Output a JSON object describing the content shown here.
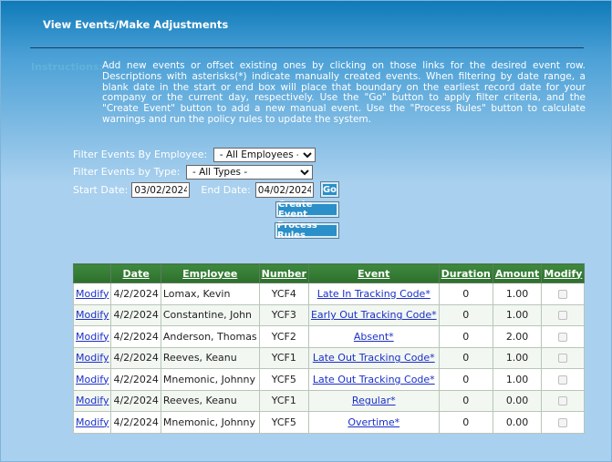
{
  "page": {
    "title": "View Events/Make Adjustments"
  },
  "instructions": {
    "label": "Instructions:",
    "text": "Add new events or offset existing ones by clicking on those links for the desired event row. Descriptions with asterisks(*) indicate manually created events.  When filtering by date range, a blank date in the start or end box will place that boundary on the earliest record date for your company or the current day, respectively. Use the \"Go\" button to apply filter criteria, and the \"Create Event\" button to add a new manual event. Use the \"Process Rules\" button to calculate warnings and run the policy rules to update the system."
  },
  "filters": {
    "employee_label": "Filter Events By Employee:",
    "employee_value": "- All Employees -",
    "type_label": "Filter Events by Type:",
    "type_value": "- All Types -",
    "start_label": "Start Date:",
    "start_value": "03/02/2024",
    "end_label": "End Date:",
    "end_value": "04/02/2024",
    "go_label": "Go"
  },
  "actions": {
    "create_event_label": "Create Event",
    "process_rules_label": "Process Rules"
  },
  "table": {
    "headers": [
      "",
      "Date",
      "Employee",
      "Number",
      "Event",
      "Duration",
      "Amount",
      "Modify"
    ],
    "rows": [
      {
        "action": "Modify",
        "date": "4/2/2024",
        "employee": "Lomax, Kevin",
        "number": "YCF4",
        "event": "Late In Tracking Code*",
        "duration": "0",
        "amount": "1.00"
      },
      {
        "action": "Modify",
        "date": "4/2/2024",
        "employee": "Constantine, John",
        "number": "YCF3",
        "event": "Early Out Tracking Code*",
        "duration": "0",
        "amount": "1.00"
      },
      {
        "action": "Modify",
        "date": "4/2/2024",
        "employee": "Anderson, Thomas",
        "number": "YCF2",
        "event": "Absent*",
        "duration": "0",
        "amount": "2.00"
      },
      {
        "action": "Modify",
        "date": "4/2/2024",
        "employee": "Reeves, Keanu",
        "number": "YCF1",
        "event": "Late Out Tracking Code*",
        "duration": "0",
        "amount": "1.00"
      },
      {
        "action": "Modify",
        "date": "4/2/2024",
        "employee": "Mnemonic, Johnny",
        "number": "YCF5",
        "event": "Late Out Tracking Code*",
        "duration": "0",
        "amount": "1.00"
      },
      {
        "action": "Modify",
        "date": "4/2/2024",
        "employee": "Reeves, Keanu",
        "number": "YCF1",
        "event": "Regular*",
        "duration": "0",
        "amount": "0.00"
      },
      {
        "action": "Modify",
        "date": "4/2/2024",
        "employee": "Mnemonic, Johnny",
        "number": "YCF5",
        "event": "Overtime*",
        "duration": "0",
        "amount": "0.00"
      }
    ]
  }
}
